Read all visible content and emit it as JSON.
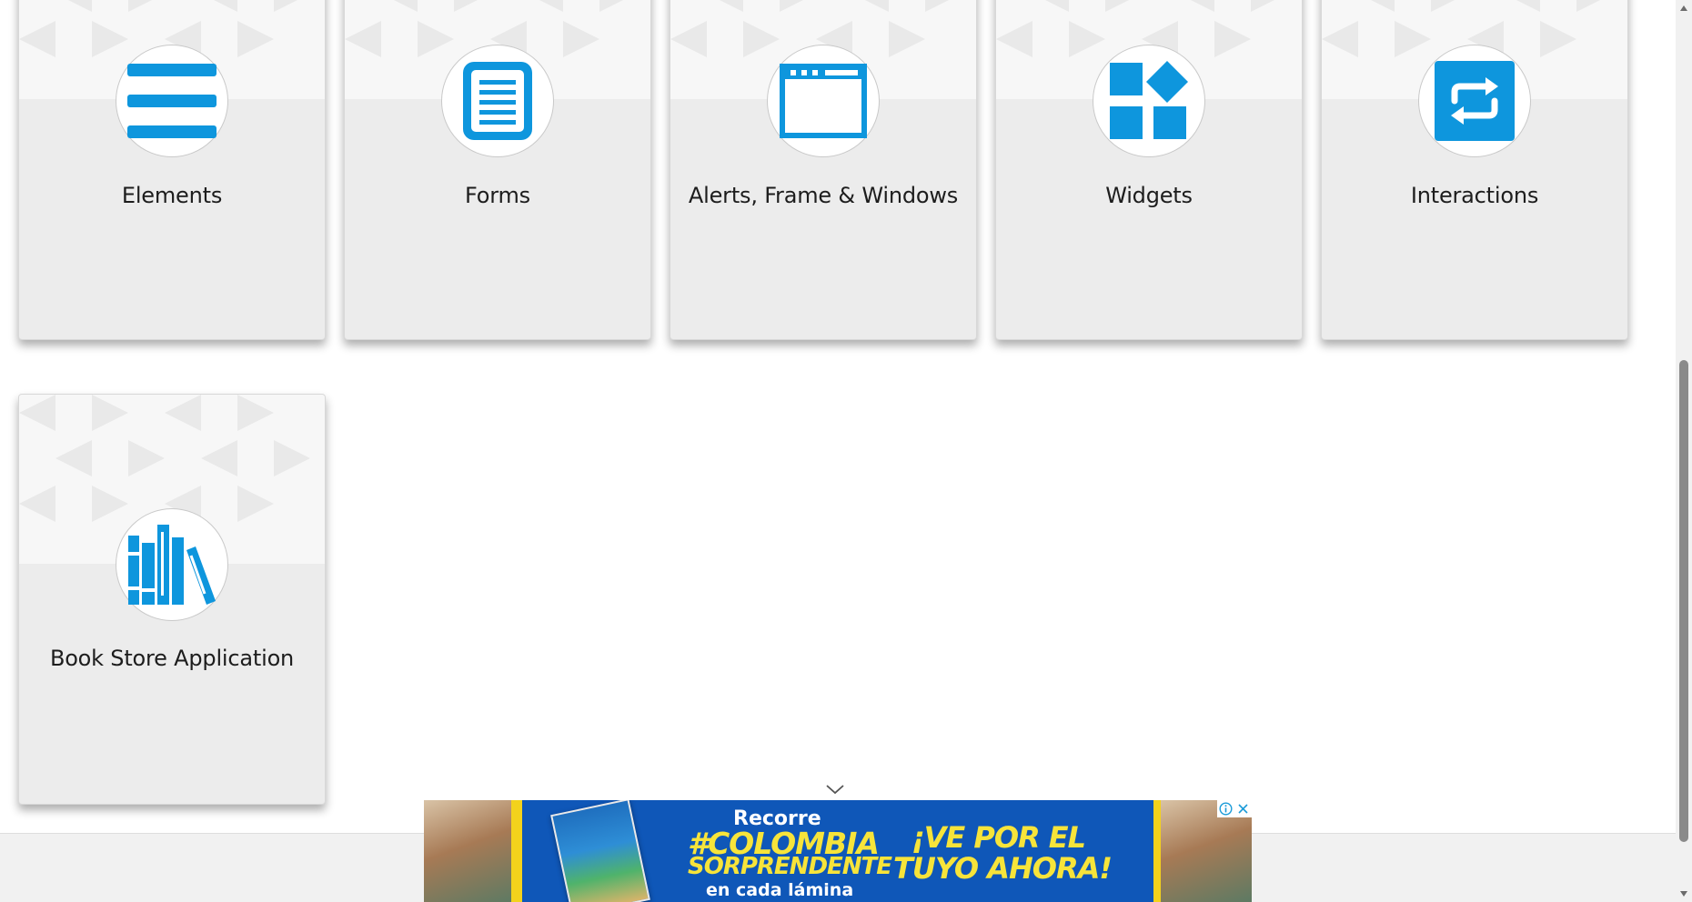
{
  "cards": [
    {
      "label": "Elements",
      "icon": "hamburger-lines-icon"
    },
    {
      "label": "Forms",
      "icon": "document-list-icon"
    },
    {
      "label": "Alerts, Frame & Windows",
      "icon": "browser-window-icon"
    },
    {
      "label": "Widgets",
      "icon": "widgets-squares-icon"
    },
    {
      "label": "Interactions",
      "icon": "swap-arrows-icon"
    },
    {
      "label": "Book Store Application",
      "icon": "books-icon"
    }
  ],
  "colors": {
    "accent": "#0e96dd",
    "card_bg": "#ececec",
    "ad_blue": "#0f57b8",
    "ad_yellow": "#f7e43a"
  },
  "ad": {
    "line1": "Recorre",
    "line2": "#COLOMBIA",
    "line3": "SORPRENDENTE",
    "line4": "en cada lámina",
    "cta_line1": "¡VE POR EL",
    "cta_line2": "TUYO AHORA!",
    "info_icon": "info-icon",
    "close_icon": "close-icon"
  }
}
